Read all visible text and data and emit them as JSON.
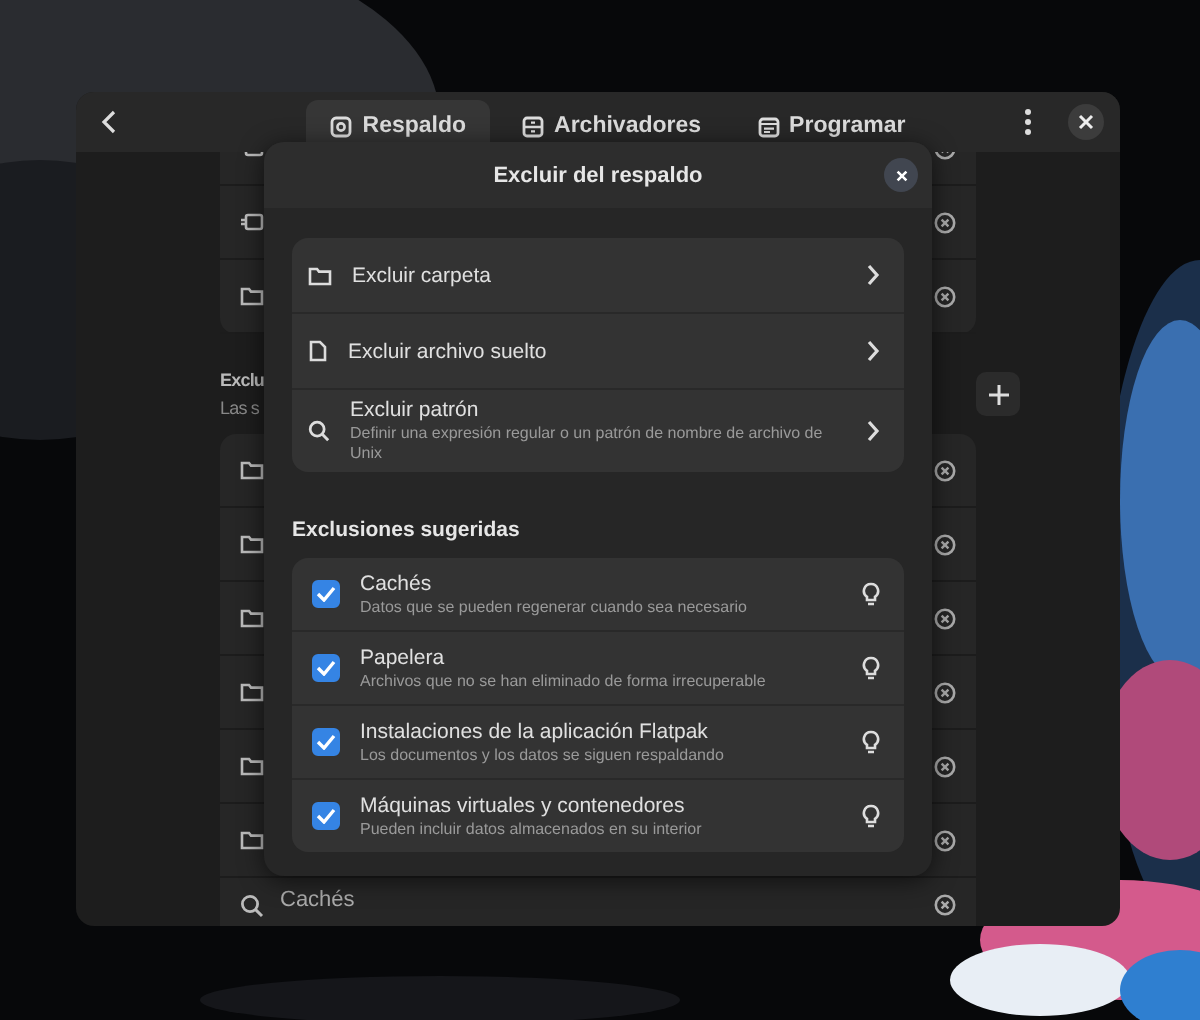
{
  "window": {
    "tabs": [
      {
        "label": "Respaldo",
        "selected": true
      },
      {
        "label": "Archivadores",
        "selected": false
      },
      {
        "label": "Programar",
        "selected": false
      }
    ]
  },
  "page": {
    "section_title": "Exclu",
    "section_subtitle": "Las s",
    "bottom_row": {
      "title": "Cachés"
    }
  },
  "dialog": {
    "title": "Excluir del respaldo",
    "actions": [
      {
        "kind": "folder",
        "title": "Excluir carpeta"
      },
      {
        "kind": "file",
        "title": "Excluir archivo suelto"
      },
      {
        "kind": "pattern",
        "title": "Excluir patrón",
        "subtitle": "Definir una expresión regular o un patrón de nombre de archivo de Unix"
      }
    ],
    "suggested": {
      "title": "Exclusiones sugeridas",
      "items": [
        {
          "title": "Cachés",
          "subtitle": "Datos que se pueden regenerar cuando sea necesario",
          "checked": true
        },
        {
          "title": "Papelera",
          "subtitle": "Archivos que no se han eliminado de forma irrecuperable",
          "checked": true
        },
        {
          "title": "Instalaciones de la aplicación Flatpak",
          "subtitle": "Los documentos y los datos se siguen respaldando",
          "checked": true
        },
        {
          "title": "Máquinas virtuales y contenedores",
          "subtitle": "Pueden incluir datos almacenados en su interior",
          "checked": true
        }
      ]
    }
  }
}
